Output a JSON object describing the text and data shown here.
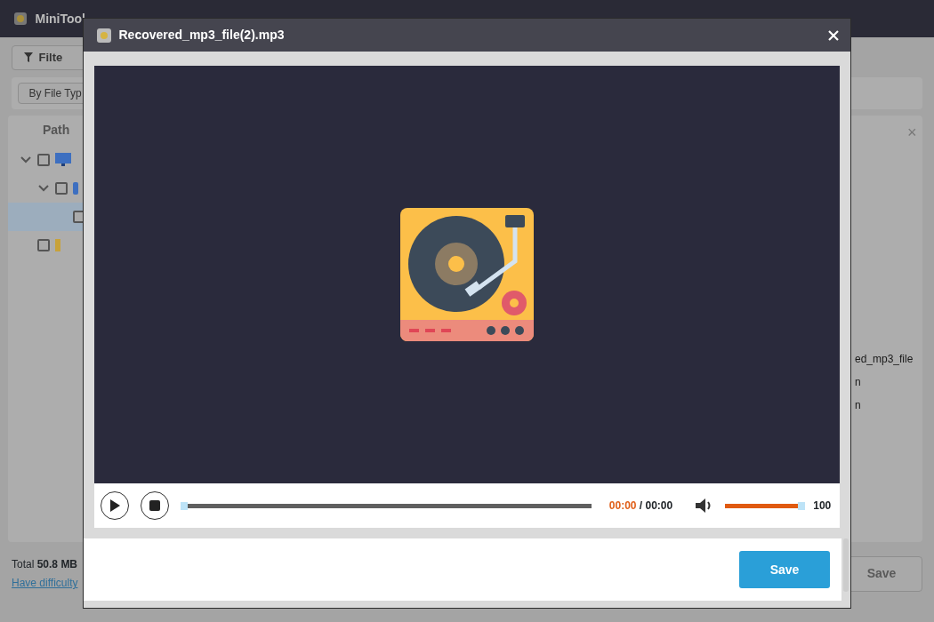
{
  "app": {
    "title": "MiniTool",
    "filter_button": "Filte",
    "filter_tab": "By File Typ",
    "tree": {
      "column": "Path",
      "items": [
        {
          "kind": "computer",
          "checked": false,
          "expanded": true,
          "children": [
            {
              "kind": "drive",
              "checked": false,
              "expanded": true,
              "children": [
                {
                  "checked": false,
                  "selected": true
                }
              ]
            }
          ]
        },
        {
          "kind": "folder",
          "checked": false
        }
      ]
    },
    "details_close": "×",
    "details_partial": [
      "ed_mp3_file",
      "n",
      "n"
    ],
    "footer": {
      "total_label": "Total",
      "total_value": "50.8 MB",
      "help_link": "Have difficulty",
      "save_button": "Save",
      "save_disabled": true
    }
  },
  "dialog": {
    "title": "Recovered_mp3_file(2).mp3",
    "player": {
      "seek": {
        "level": 0
      },
      "elapsed": "00:00",
      "separator": "/",
      "duration": "00:00",
      "volume": {
        "level": 1,
        "value": "100"
      }
    },
    "save_button": "Save"
  }
}
